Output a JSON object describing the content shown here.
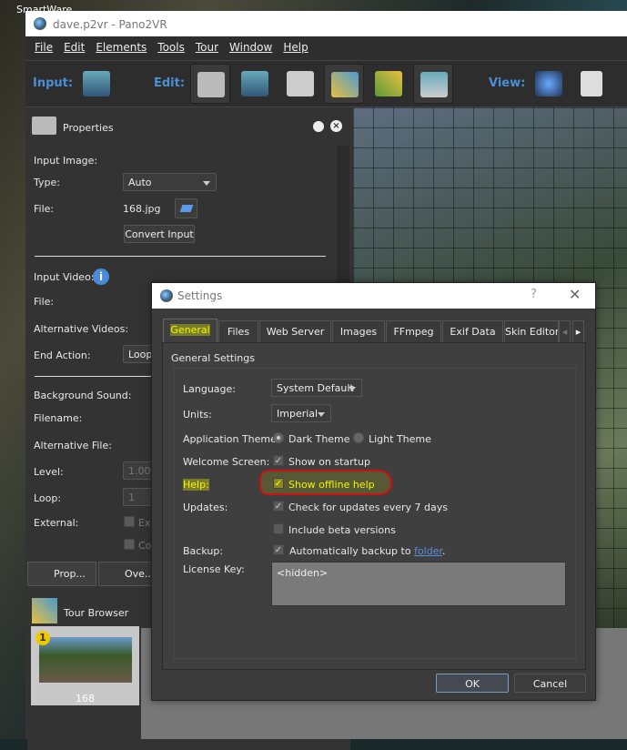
{
  "desktop": {
    "label": "SmartWare"
  },
  "window": {
    "title": "dave.p2vr - Pano2VR"
  },
  "menu": [
    "File",
    "Edit",
    "Elements",
    "Tools",
    "Tour",
    "Window",
    "Help"
  ],
  "toolbar": {
    "input_label": "Input:",
    "edit_label": "Edit:",
    "view_label": "View:"
  },
  "properties": {
    "title": "Properties",
    "input_image": "Input Image:",
    "type_label": "Type:",
    "type_value": "Auto",
    "file_label": "File:",
    "file_value": "168.jpg",
    "convert_button": "Convert Input",
    "input_video": "Input Video:",
    "video_file_label": "File:",
    "alt_videos": "Alternative Videos:",
    "end_action_label": "End Action:",
    "end_action_value": "Loop",
    "bg_sound": "Background Sound:",
    "filename": "Filename:",
    "alt_file": "Alternative File:",
    "level_label": "Level:",
    "level_value": "1.00",
    "loop_label": "Loop:",
    "loop_value": "1",
    "external_label": "External:",
    "external_cb1": "Ex",
    "external_cb2": "Co"
  },
  "panel_tabs": [
    "Prop...",
    "Ove..."
  ],
  "tour_browser": {
    "title": "Tour Browser",
    "node_badge": "1",
    "node_label": "168"
  },
  "settings": {
    "title": "Settings",
    "help_btn": "?",
    "tabs": [
      "General",
      "Files",
      "Web Server",
      "Images",
      "FFmpeg",
      "Exif Data",
      "Skin Editor"
    ],
    "active_tab": "General",
    "section": "General Settings",
    "language_label": "Language:",
    "language_value": "System Default",
    "units_label": "Units:",
    "units_value": "Imperial",
    "theme_label": "Application Theme:",
    "theme_dark": "Dark Theme",
    "theme_light": "Light Theme",
    "theme_selected": "Dark Theme",
    "welcome_label": "Welcome Screen:",
    "welcome_cb": "Show on startup",
    "welcome_checked": true,
    "help_label": "Help:",
    "help_cb": "Show offline help",
    "help_checked": true,
    "updates_label": "Updates:",
    "updates_cb": "Check for updates every 7 days",
    "updates_checked": true,
    "beta_cb": "Include beta versions",
    "beta_checked": false,
    "backup_label": "Backup:",
    "backup_cb": "Automatically backup to",
    "backup_link": "folder",
    "backup_checked": true,
    "license_label": "License Key:",
    "license_value": "<hidden>",
    "ok": "OK",
    "cancel": "Cancel"
  },
  "colors": {
    "accent": "#4b8fd6",
    "highlight": "#e6f000",
    "annotation": "#d01010",
    "link": "#5a8fe0"
  }
}
